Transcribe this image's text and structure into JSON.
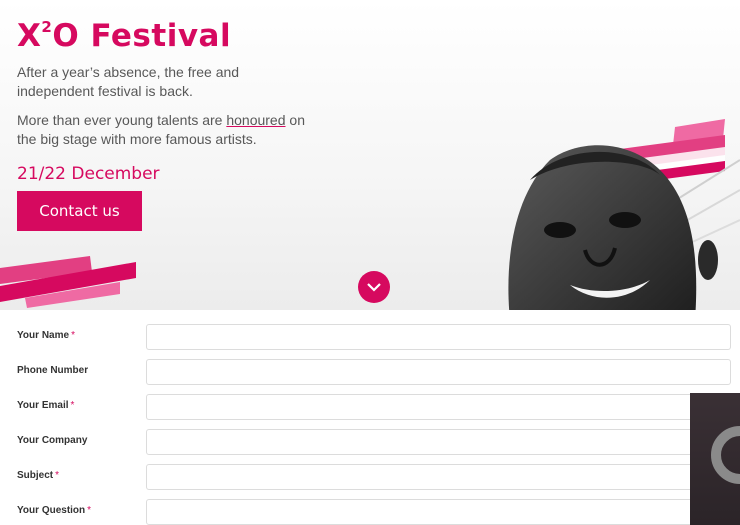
{
  "hero": {
    "title_x": "X",
    "title_sup": "2",
    "title_rest": "O Festival",
    "paragraph1": "After a year’s absence, the free and independent festival is back.",
    "paragraph2_before": "More than ever young talents are ",
    "paragraph2_link": "honoured",
    "paragraph2_after": " on the big stage with more famous artists.",
    "date": "21/22 December",
    "contact_label": "Contact us",
    "scroll_icon": "chevron-down-icon"
  },
  "form": {
    "required_mark": "*",
    "fields": [
      {
        "label": "Your Name",
        "required": true,
        "value": "",
        "placeholder": ""
      },
      {
        "label": "Phone Number",
        "required": false,
        "value": "",
        "placeholder": ""
      },
      {
        "label": "Your Email",
        "required": true,
        "value": "",
        "placeholder": ""
      },
      {
        "label": "Your Company",
        "required": false,
        "value": "",
        "placeholder": ""
      },
      {
        "label": "Subject",
        "required": true,
        "value": "",
        "placeholder": ""
      },
      {
        "label": "Your Question",
        "required": true,
        "value": "",
        "placeholder": ""
      }
    ]
  },
  "colors": {
    "accent": "#d6095f",
    "stripe_light": "#ef6aa3",
    "text": "#585858"
  }
}
